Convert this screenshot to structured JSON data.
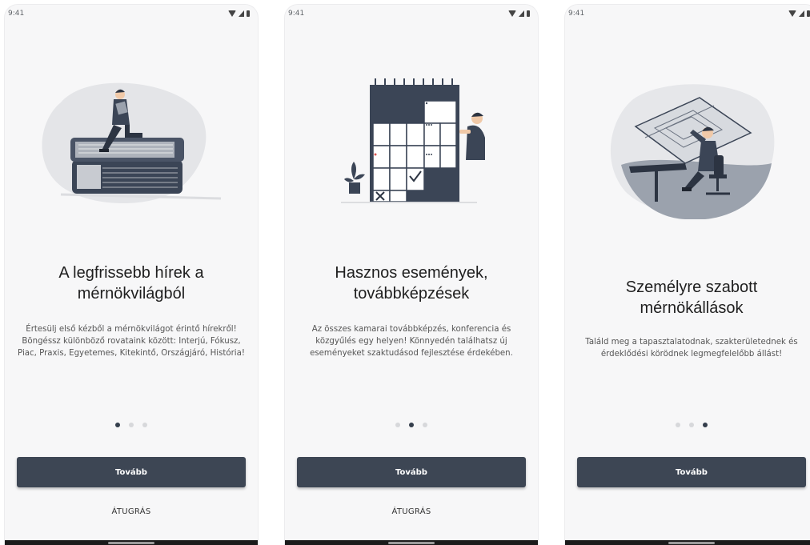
{
  "screens": [
    {
      "time": "9:41",
      "title": "A legfrissebb hírek a mérnökvilágból",
      "description": "Értesülj első kézből a mérnökvilágot érintő hírekről! Böngéssz különböző rovataink között: Interjú, Fókusz, Piac, Praxis, Egyetemes, Kitekintő, Országjáró, História!",
      "next_label": "Tovább",
      "skip_label": "ÁTUGRÁS",
      "page_index": 1,
      "page_count": 3
    },
    {
      "time": "9:41",
      "title": "Hasznos események, továbbképzések",
      "description": "Az összes kamarai továbbképzés, konferencia és közgyűlés egy helyen! Könnyedén találhatsz új eseményeket szaktudásod fejlesztése érdekében.",
      "next_label": "Tovább",
      "skip_label": "ÁTUGRÁS",
      "page_index": 2,
      "page_count": 3
    },
    {
      "time": "9:41",
      "title": "Személyre szabott mérnökállások",
      "description": "Találd meg a tapasztalatodnak, szakterületednek és érdeklődési körödnek legmegfelelőbb állást!",
      "next_label": "Tovább",
      "skip_label": null,
      "page_index": 3,
      "page_count": 3
    }
  ],
  "colors": {
    "button": "#3d4654",
    "dot_active": "#343e4c",
    "dot_inactive": "#d7d8db",
    "screen_bg": "#f7f7f8",
    "blob": "#e4e5e8",
    "figure": "#3b4556"
  }
}
